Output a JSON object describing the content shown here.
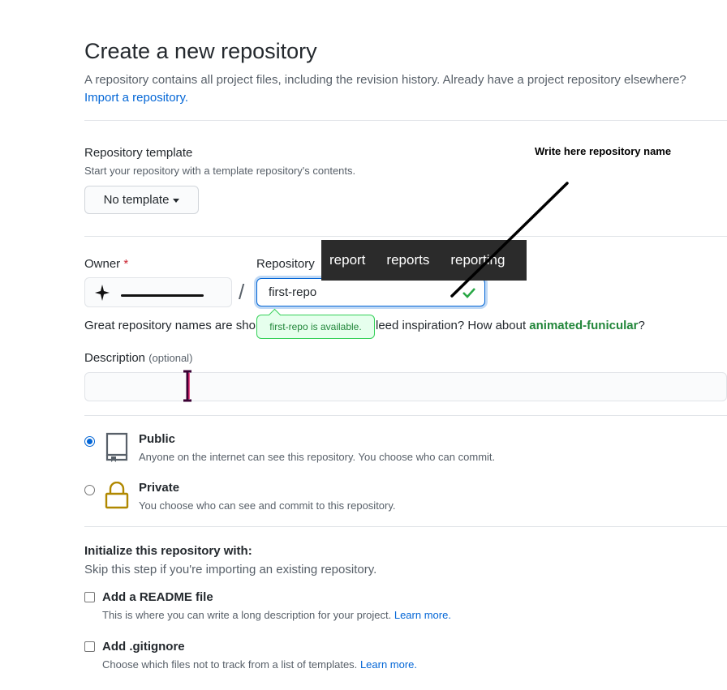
{
  "header": {
    "title": "Create a new repository",
    "subtitle": "A repository contains all project files, including the revision history. Already have a project repository elsewhere?",
    "import_link": "Import a repository."
  },
  "template": {
    "label": "Repository template",
    "help": "Start your repository with a template repository's contents.",
    "button_label": "No template"
  },
  "owner": {
    "label": "Owner",
    "required_mark": "*"
  },
  "repo_name": {
    "label": "Repository",
    "value": "first-repo",
    "available_text": "first-repo is available.",
    "separator": "/"
  },
  "suggestions": [
    "report",
    "reports",
    "reporting"
  ],
  "tip": {
    "prefix": "Great repository names are sho",
    "middle": "leed inspiration? How about ",
    "suggestion": "animated-funicular",
    "suffix": "?"
  },
  "description": {
    "label": "Description",
    "optional": "(optional)",
    "value": ""
  },
  "visibility": {
    "public": {
      "label": "Public",
      "help": "Anyone on the internet can see this repository. You choose who can commit.",
      "selected": true
    },
    "private": {
      "label": "Private",
      "help": "You choose who can see and commit to this repository.",
      "selected": false
    }
  },
  "initialize": {
    "title": "Initialize this repository with:",
    "help": "Skip this step if you're importing an existing repository.",
    "readme": {
      "label": "Add a README file",
      "help": "This is where you can write a long description for your project.",
      "learn_more": "Learn more."
    },
    "gitignore": {
      "label": "Add .gitignore",
      "help": "Choose which files not to track from a list of templates.",
      "learn_more": "Learn more."
    }
  },
  "annotation": {
    "text": "Write here repository name"
  },
  "colors": {
    "accent": "#0366d6",
    "success": "#22863a",
    "required": "#cb2431"
  }
}
